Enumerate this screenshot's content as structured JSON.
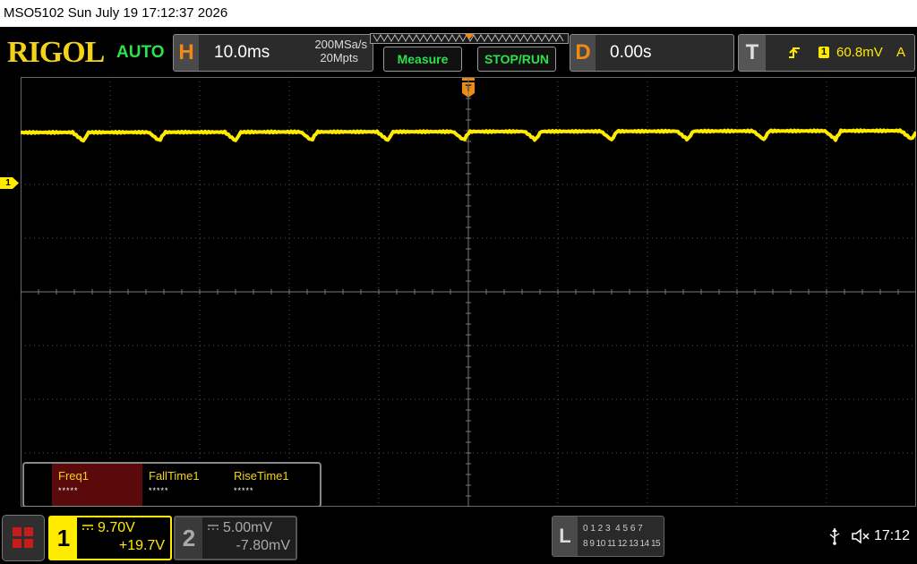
{
  "title_bar": {
    "text": "MSO5102  Sun July 19 17:12:37 2026"
  },
  "brand": {
    "logo": "RIGOL",
    "trigger_mode": "AUTO"
  },
  "horizontal": {
    "letter": "H",
    "timebase": "10.0ms",
    "sample_rate": "200MSa/s",
    "memory_depth": "20Mpts"
  },
  "buttons": {
    "measure": "Measure",
    "stop_run": "STOP/RUN"
  },
  "delay": {
    "letter": "D",
    "value": "0.00s"
  },
  "trigger": {
    "letter": "T",
    "channel": "1",
    "level": "60.8mV",
    "coupling": "A"
  },
  "trigger_marker": {
    "label": "T"
  },
  "channel1_marker": {
    "label": "1"
  },
  "measurements": [
    {
      "label": "Freq1",
      "value": "*****"
    },
    {
      "label": "FallTime1",
      "value": "*****"
    },
    {
      "label": "RiseTime1",
      "value": "*****"
    }
  ],
  "channel1": {
    "number": "1",
    "scale": "9.70V",
    "offset": "+19.7V",
    "color": "#ffeb00"
  },
  "channel2": {
    "number": "2",
    "scale": "5.00mV",
    "offset": "-7.80mV"
  },
  "logic": {
    "letter": "L",
    "row1": "0 1 2 3  4 5 6 7",
    "row2": "8 9 10 11 12 13 14 15"
  },
  "status": {
    "time": "17:12"
  },
  "colors": {
    "trace": "#ffeb00",
    "accent_orange": "#f08a12",
    "auto_green": "#2ee04a",
    "logo_yellow": "#f3d219"
  },
  "chart_data": {
    "type": "line",
    "series": [
      {
        "values_y_divs": [
          2.95,
          2.96,
          2.95,
          2.95,
          2.96,
          2.95,
          2.95,
          2.95,
          2.95,
          2.95,
          2.95,
          2.95
        ]
      }
    ],
    "notch_x_divs": [
      0.7,
      1.55,
      2.4,
      3.25,
      4.1,
      4.95,
      5.75,
      6.6,
      7.45,
      8.3,
      9.1,
      9.95
    ],
    "grid": true,
    "divisions": {
      "x": 10,
      "y": 8
    }
  }
}
